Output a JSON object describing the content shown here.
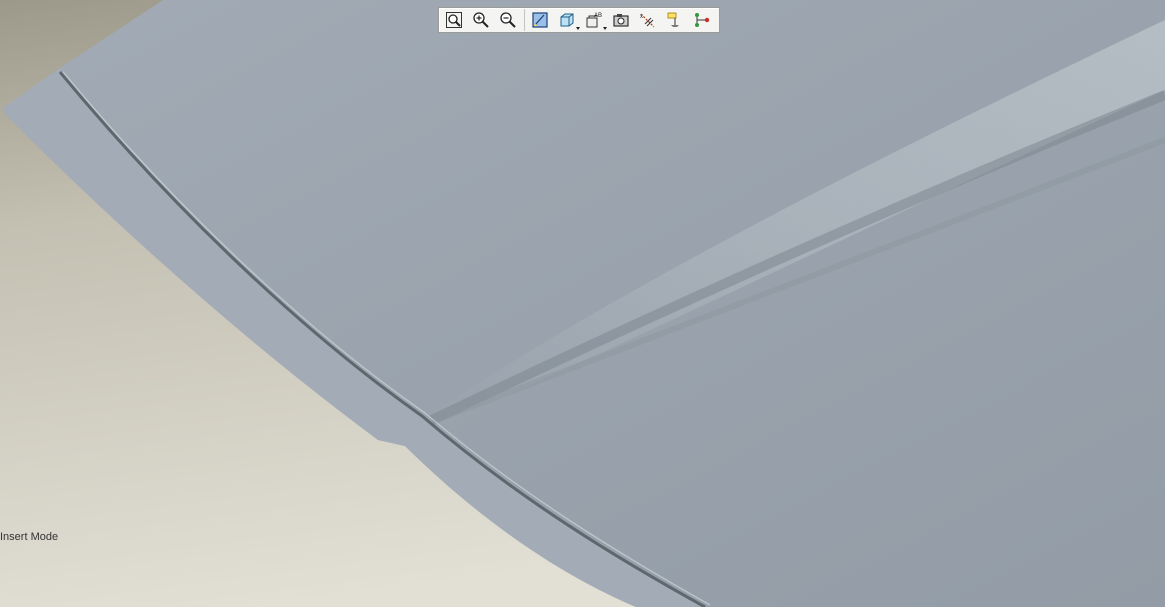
{
  "colors": {
    "background_top": "#9c988a",
    "background_bottom": "#e2e0d5",
    "surface": "#98a1ab",
    "surface_light": "#a7afb8",
    "crease": "#5e666e"
  },
  "toolbar": {
    "buttons": [
      {
        "icon": "zoom-fit-icon"
      },
      {
        "icon": "zoom-in-icon"
      },
      {
        "icon": "zoom-out-icon"
      },
      {
        "icon": "repaint-icon"
      },
      {
        "icon": "saved-view-icon"
      },
      {
        "icon": "datum-display-icon"
      },
      {
        "icon": "camera-icon"
      },
      {
        "icon": "datum-axis-icon"
      },
      {
        "icon": "datum-plane-icon"
      },
      {
        "icon": "network-icon"
      }
    ]
  },
  "status": {
    "mode": "Insert Mode"
  }
}
